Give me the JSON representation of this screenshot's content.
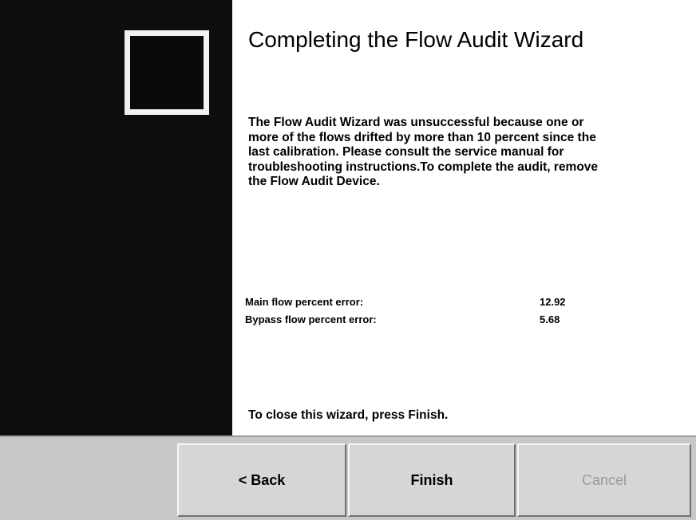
{
  "wizard": {
    "title": "Completing the Flow Audit Wizard",
    "message": "The Flow Audit Wizard was unsuccessful because one or more of the flows drifted by more than 10 percent since the last calibration. Please consult the service manual for troubleshooting instructions.To complete the audit, remove the Flow Audit Device.",
    "results": [
      {
        "label": "Main  flow percent error:",
        "value": "12.92"
      },
      {
        "label": "Bypass flow percent error:",
        "value": "5.68"
      }
    ],
    "closing": "To close this wizard, press Finish."
  },
  "buttons": {
    "back": "< Back",
    "finish": "Finish",
    "cancel": "Cancel",
    "cancel_enabled": false
  },
  "colors": {
    "sidebar": "#0e0e0e",
    "button_face": "#d6d6d6",
    "button_bar": "#c8c8c8",
    "disabled_text": "#9a9a9a"
  }
}
